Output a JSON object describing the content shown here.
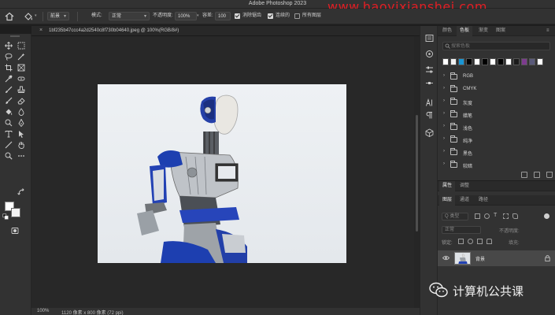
{
  "app": {
    "title": "Adobe Photoshop 2023"
  },
  "watermark": {
    "text": "www.haoyixianshei.com"
  },
  "options": {
    "preset_label": "前景",
    "mode_label": "模式:",
    "mode_value": "正常",
    "opacity_label": "不透明度:",
    "opacity_value": "100%",
    "tolerance_label": "容差:",
    "tolerance_value": "100",
    "antialias_label": "消除锯齿",
    "contiguous_label": "连续的",
    "all_layers_label": "所有图层"
  },
  "document": {
    "tab_title": "1bf235b47ccc4a2d2540c8f730b04640.jpeg @ 100%(RGB/8#)",
    "close_glyph": "×"
  },
  "status": {
    "zoom": "100%",
    "size_info": "1120 像素 x 800 像素 (72 ppi)"
  },
  "swatches_panel": {
    "tabs": [
      {
        "label": "颜色"
      },
      {
        "label": "色板"
      },
      {
        "label": "渐变"
      },
      {
        "label": "图案"
      }
    ],
    "search_placeholder": "搜索色板",
    "recent_colors": [
      "#ffffff",
      "#f2f2f2",
      "#1a96d4",
      "#000000",
      "#ffffff",
      "#000000",
      "#ffffff",
      "#000000",
      "#ffffff",
      "#1b1b1b",
      "#7d3b8e",
      "#5a5a7a",
      "#ffffff"
    ],
    "groups": [
      {
        "name": "RGB"
      },
      {
        "name": "CMYK"
      },
      {
        "name": "灰度"
      },
      {
        "name": "蜡笔"
      },
      {
        "name": "浅色"
      },
      {
        "name": "纯净"
      },
      {
        "name": "黑色"
      },
      {
        "name": "较暗"
      }
    ]
  },
  "layers_panel": {
    "top_tabs": [
      {
        "label": "属性"
      },
      {
        "label": "调整"
      }
    ],
    "tabs": [
      {
        "label": "图层"
      },
      {
        "label": "通道"
      },
      {
        "label": "路径"
      }
    ],
    "filter_placeholder": "Q 类型",
    "blend_mode": "正常",
    "opacity_label": "不透明度:",
    "lock_label": "锁定:",
    "fill_label": "填充:",
    "layer_name": "背景"
  },
  "brand": {
    "text": "计算机公共课"
  },
  "colors": {
    "ui_bg": "#323232",
    "canvas_bg": "#282828",
    "robot_blue": "#1d3fb0",
    "watermark_red": "#e31e24"
  }
}
